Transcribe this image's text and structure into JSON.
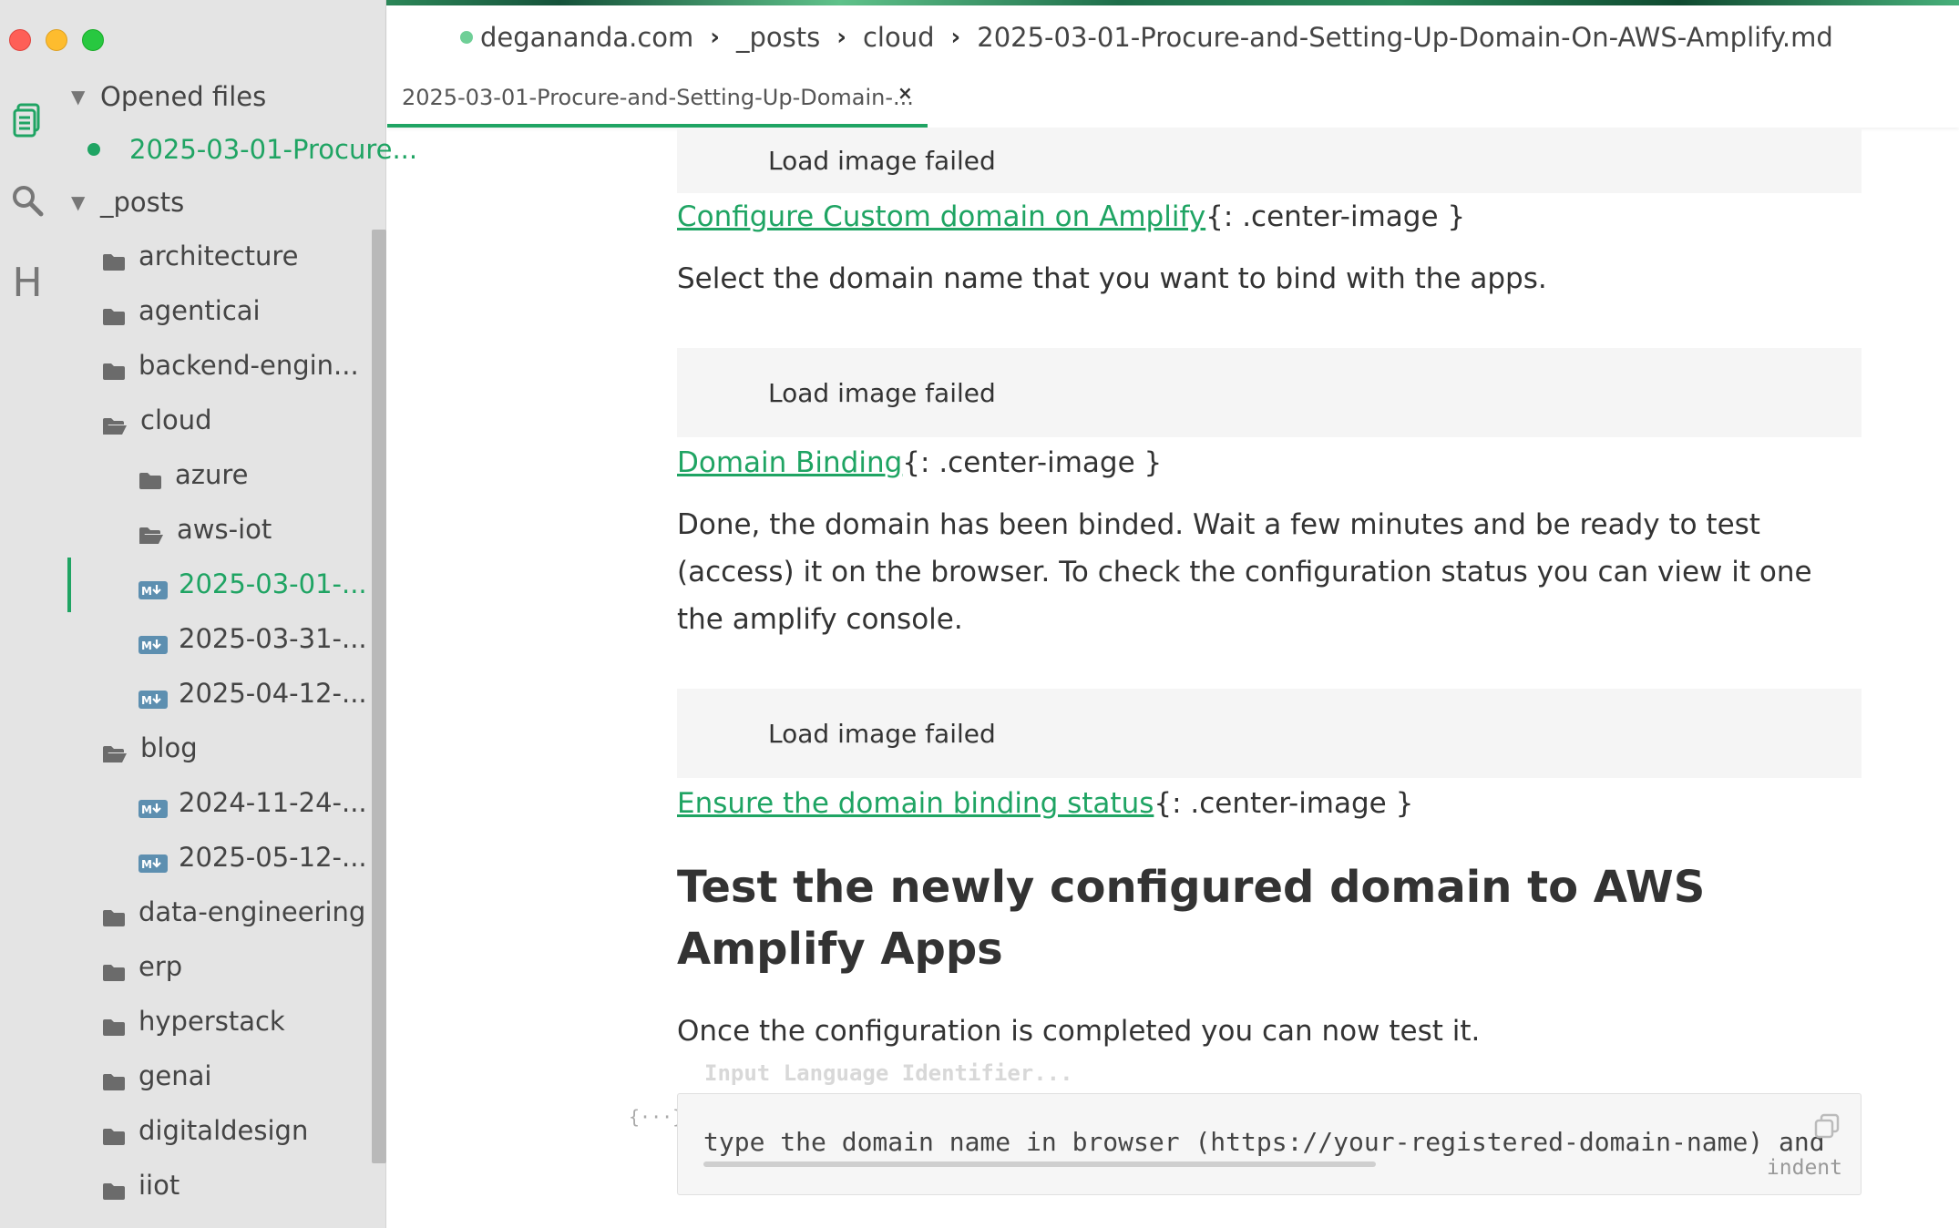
{
  "window": {
    "controls": [
      "close",
      "minimize",
      "maximize"
    ]
  },
  "sidebar": {
    "rail_icons": [
      "files-icon",
      "search-icon",
      "heading-icon"
    ],
    "rail_heading_glyph": "H",
    "opened_files_label": "Opened files",
    "opened_file": "2025-03-01-Procure...",
    "root_label": "_posts",
    "items": [
      {
        "label": "architecture",
        "kind": "folder"
      },
      {
        "label": "agenticai",
        "kind": "folder"
      },
      {
        "label": "backend-engin...",
        "kind": "folder"
      },
      {
        "label": "cloud",
        "kind": "folder-open"
      },
      {
        "label": "azure",
        "kind": "folder"
      },
      {
        "label": "aws-iot",
        "kind": "folder-open"
      },
      {
        "label": "2025-03-01-...",
        "kind": "markdown",
        "active": true
      },
      {
        "label": "2025-03-31-...",
        "kind": "markdown"
      },
      {
        "label": "2025-04-12-...",
        "kind": "markdown"
      },
      {
        "label": "blog",
        "kind": "folder-open"
      },
      {
        "label": "2024-11-24-...",
        "kind": "markdown"
      },
      {
        "label": "2025-05-12-...",
        "kind": "markdown"
      },
      {
        "label": "data-engineering",
        "kind": "folder"
      },
      {
        "label": "erp",
        "kind": "folder"
      },
      {
        "label": "hyperstack",
        "kind": "folder"
      },
      {
        "label": "genai",
        "kind": "folder"
      },
      {
        "label": "digitaldesign",
        "kind": "folder"
      },
      {
        "label": "iiot",
        "kind": "folder"
      }
    ]
  },
  "header": {
    "breadcrumb": [
      "degananda.com",
      "_posts",
      "cloud",
      "2025-03-01-Procure-and-Setting-Up-Domain-On-AWS-Amplify.md"
    ],
    "tab_title": "2025-03-01-Procure-and-Setting-Up-Domain-...",
    "tab_close": "×"
  },
  "content": {
    "image_failed_text": "Load image failed",
    "caption1_link": "Configure Custom domain on Amplify",
    "caption_suffix": "{: .center-image }",
    "para1": "Select the domain name that you want to bind with the apps.",
    "caption2_link": "Domain Binding",
    "para2": "Done, the domain has been binded. Wait a few minutes and be ready to test (access) it on the browser. To check the configuration status you can view it one the amplify console.",
    "caption3_link": "Ensure the domain binding status",
    "heading": "Test the newly configured domain to AWS Amplify Apps",
    "para3": "Once the configuration is completed you can now test it.",
    "code_lang_placeholder": "Input Language Identifier...",
    "code_fence_glyph": "{···}",
    "code_text": "type the domain name in browser (https://your-registered-domain-name) and",
    "code_indent": "indent"
  },
  "colors": {
    "accent": "#1fa463",
    "sidebar_bg": "#e4e4e4"
  }
}
